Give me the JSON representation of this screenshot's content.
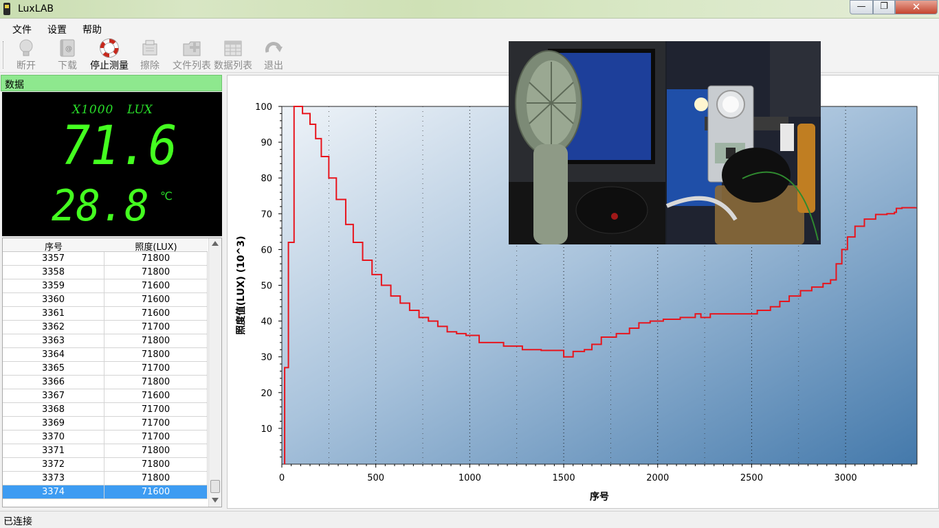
{
  "window": {
    "title": "LuxLAB",
    "min_symbol": "—",
    "max_symbol": "❐",
    "close_symbol": "✕"
  },
  "menu": [
    "文件",
    "设置",
    "帮助"
  ],
  "toolbar": [
    {
      "label": "断开",
      "icon": "bulb-icon",
      "enabled": false
    },
    {
      "label": "下载",
      "icon": "download-book-icon",
      "enabled": false
    },
    {
      "label": "停止测量",
      "icon": "lifebuoy-icon",
      "enabled": true
    },
    {
      "label": "擦除",
      "icon": "erase-icon",
      "enabled": false
    },
    {
      "label": "文件列表",
      "icon": "folder-add-icon",
      "enabled": false
    },
    {
      "label": "数据列表",
      "icon": "data-table-icon",
      "enabled": false
    },
    {
      "label": "退出",
      "icon": "exit-arrow-icon",
      "enabled": false
    }
  ],
  "panel": {
    "title": "数据",
    "scale": "X1000",
    "unit": "LUX",
    "lux_value": "71.6",
    "temp_value": "28.8",
    "temp_unit": "℃"
  },
  "table": {
    "headers": [
      "序号",
      "照度(LUX)"
    ],
    "rows": [
      [
        "3357",
        "71800"
      ],
      [
        "3358",
        "71800"
      ],
      [
        "3359",
        "71600"
      ],
      [
        "3360",
        "71600"
      ],
      [
        "3361",
        "71600"
      ],
      [
        "3362",
        "71700"
      ],
      [
        "3363",
        "71800"
      ],
      [
        "3364",
        "71800"
      ],
      [
        "3365",
        "71700"
      ],
      [
        "3366",
        "71800"
      ],
      [
        "3367",
        "71600"
      ],
      [
        "3368",
        "71700"
      ],
      [
        "3369",
        "71700"
      ],
      [
        "3370",
        "71700"
      ],
      [
        "3371",
        "71800"
      ],
      [
        "3372",
        "71800"
      ],
      [
        "3373",
        "71800"
      ],
      [
        "3374",
        "71600"
      ]
    ],
    "selected_index": 17
  },
  "chart_data": {
    "type": "line",
    "xlabel": "序号",
    "ylabel": "照度值(LUX)  (10^3)",
    "xlim": [
      0,
      3380
    ],
    "ylim": [
      0,
      100
    ],
    "xticks": [
      0,
      500,
      1000,
      1500,
      2000,
      2500,
      3000
    ],
    "yticks": [
      10,
      20,
      30,
      40,
      50,
      60,
      70,
      80,
      90,
      100
    ],
    "grid": "vertical-dotted",
    "series": [
      {
        "color": "#e8141c",
        "points": [
          [
            15,
            0
          ],
          [
            15,
            27
          ],
          [
            35,
            27
          ],
          [
            35,
            62
          ],
          [
            60,
            62
          ],
          [
            65,
            100
          ],
          [
            105,
            100
          ],
          [
            110,
            98
          ],
          [
            130,
            98
          ],
          [
            150,
            95
          ],
          [
            180,
            91
          ],
          [
            210,
            86
          ],
          [
            250,
            80
          ],
          [
            290,
            74
          ],
          [
            340,
            67
          ],
          [
            380,
            62
          ],
          [
            430,
            57
          ],
          [
            480,
            53
          ],
          [
            530,
            50
          ],
          [
            580,
            47
          ],
          [
            630,
            45
          ],
          [
            680,
            43
          ],
          [
            730,
            41
          ],
          [
            780,
            40
          ],
          [
            830,
            38.5
          ],
          [
            880,
            37
          ],
          [
            930,
            36.5
          ],
          [
            980,
            36
          ],
          [
            1030,
            36
          ],
          [
            1050,
            34
          ],
          [
            1120,
            34
          ],
          [
            1180,
            33
          ],
          [
            1280,
            32
          ],
          [
            1380,
            31.8
          ],
          [
            1490,
            31.8
          ],
          [
            1500,
            30
          ],
          [
            1530,
            30
          ],
          [
            1550,
            31.5
          ],
          [
            1610,
            32
          ],
          [
            1650,
            33.5
          ],
          [
            1700,
            35.5
          ],
          [
            1780,
            36.5
          ],
          [
            1850,
            38
          ],
          [
            1900,
            39.5
          ],
          [
            1960,
            40
          ],
          [
            2030,
            40.5
          ],
          [
            2120,
            41
          ],
          [
            2200,
            42
          ],
          [
            2230,
            41
          ],
          [
            2280,
            42
          ],
          [
            2380,
            42
          ],
          [
            2460,
            42
          ],
          [
            2510,
            42
          ],
          [
            2530,
            43
          ],
          [
            2600,
            44
          ],
          [
            2650,
            45.5
          ],
          [
            2700,
            47
          ],
          [
            2760,
            48.5
          ],
          [
            2820,
            49.5
          ],
          [
            2880,
            50.5
          ],
          [
            2920,
            51.5
          ],
          [
            2950,
            56
          ],
          [
            2980,
            60
          ],
          [
            3010,
            63.5
          ],
          [
            3050,
            66.5
          ],
          [
            3100,
            68.5
          ],
          [
            3160,
            69.8
          ],
          [
            3220,
            70
          ],
          [
            3260,
            70.4
          ],
          [
            3270,
            71.5
          ],
          [
            3300,
            71.7
          ],
          [
            3374,
            71.8
          ]
        ]
      }
    ]
  },
  "status": "已连接"
}
